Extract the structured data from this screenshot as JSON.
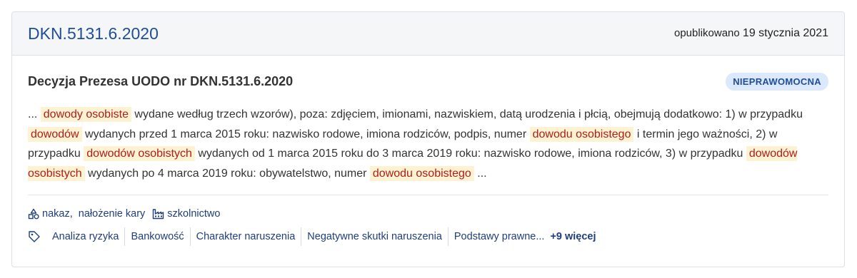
{
  "header": {
    "case_number": "DKN.5131.6.2020",
    "published_label": "opublikowano",
    "published_date": "19 stycznia 2021"
  },
  "document": {
    "title": "Decyzja Prezesa UODO nr DKN.5131.6.2020",
    "status_badge": "NIEPRAWOMOCNA"
  },
  "excerpt": {
    "p0": "... ",
    "h1": "dowody osobiste",
    "p1": " wydane według trzech wzorów), poza: zdjęciem, imionami, nazwiskiem, datą urodzenia i płcią, obejmują dodatkowo: 1) w przypadku ",
    "h2": "dowodów",
    "p2": " wydanych przed 1 marca 2015 roku: nazwisko rodowe, imiona rodziców, podpis, numer ",
    "h3": "dowodu osobistego",
    "p3": " i termin jego ważności, 2) w przypadku ",
    "h4": "dowodów osobistych",
    "p4": " wydanych od 1 marca 2015 roku do 3 marca 2019 roku: nazwisko rodowe, imiona rodziców, 3) w przypadku ",
    "h5": "dowodów osobistych",
    "p5": " wydanych po 4 marca 2019 roku: obywatelstwo, numer ",
    "h6": "dowodu osobistego",
    "p6": " ..."
  },
  "meta": {
    "sanctions_icon": "shapes-icon",
    "sanction_1": "nakaz,",
    "sanction_2": "nałożenie kary",
    "sector_icon": "factory-icon",
    "sector": "szkolnictwo"
  },
  "tags": {
    "icon": "tag-icon",
    "items": [
      "Analiza ryzyka",
      "Bankowość",
      "Charakter naruszenia",
      "Negatywne skutki naruszenia",
      "Podstawy prawne..."
    ],
    "more": "+9 więcej"
  }
}
